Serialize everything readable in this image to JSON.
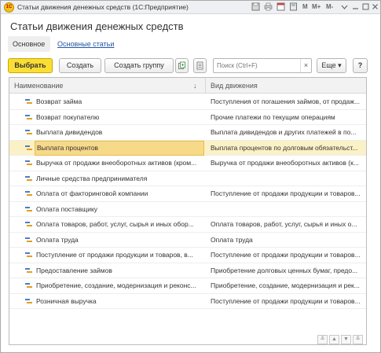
{
  "window": {
    "logo": "1С",
    "title": "Статьи движения денежных средств  (1С:Предприятие)",
    "icons": [
      "save-icon",
      "print-icon",
      "calendar-icon",
      "calculator-icon"
    ],
    "mem_labels": [
      "M",
      "M+",
      "M-"
    ],
    "controls": [
      "menu-icon",
      "minimize-icon",
      "restore-icon",
      "close-icon"
    ]
  },
  "header": {
    "title": "Статьи движения денежных средств"
  },
  "tabs": [
    {
      "label": "Основное",
      "active": true
    },
    {
      "label": "Основные статьи",
      "active": false
    }
  ],
  "toolbar": {
    "select_label": "Выбрать",
    "create_label": "Создать",
    "create_group_label": "Создать группу",
    "search_placeholder": "Поиск (Ctrl+F)",
    "clear_label": "×",
    "more_label": "Еще",
    "more_chevron": "▾",
    "help_label": "?"
  },
  "table": {
    "columns": [
      "Наименование",
      "Вид движения"
    ],
    "sort_indicator": "↓",
    "rows": [
      {
        "name": "Возврат займа",
        "kind": "Поступления от погашения займов, от продаж...",
        "selected": false
      },
      {
        "name": "Возврат покупателю",
        "kind": "Прочие платежи по текущим операциям",
        "selected": false
      },
      {
        "name": "Выплата дивидендов",
        "kind": "Выплата дивидендов и других платежей в по...",
        "selected": false
      },
      {
        "name": "Выплата процентов",
        "kind": "Выплата процентов по долговым обязательст...",
        "selected": true
      },
      {
        "name": "Выручка от продажи внеоборотных активов (кром...",
        "kind": "Выручка от продажи внеоборотных активов (к...",
        "selected": false
      },
      {
        "name": "Личные средства предпринимателя",
        "kind": "",
        "selected": false
      },
      {
        "name": "Оплата от факторинговой компании",
        "kind": "Поступление от продажи продукции и товаров...",
        "selected": false
      },
      {
        "name": "Оплата поставщику",
        "kind": "",
        "selected": false
      },
      {
        "name": "Оплата товаров, работ, услуг, сырья и иных обор...",
        "kind": "Оплата товаров, работ, услуг, сырья и иных о...",
        "selected": false
      },
      {
        "name": "Оплата труда",
        "kind": "Оплата труда",
        "selected": false
      },
      {
        "name": "Поступление от продажи продукции и товаров, в...",
        "kind": "Поступление от продажи продукции и товаров...",
        "selected": false
      },
      {
        "name": "Предоставление займов",
        "kind": "Приобретение долговых ценных бумаг, предо...",
        "selected": false
      },
      {
        "name": "Приобретение, создание, модернизация и реконс...",
        "kind": "Приобретение, создание, модернизация и рек...",
        "selected": false
      },
      {
        "name": "Розничная выручка",
        "kind": "Поступление от продажи продукции и товаров...",
        "selected": false
      }
    ]
  },
  "nav": {
    "first": "≚",
    "up": "▲",
    "down": "▼",
    "last": "≚"
  }
}
